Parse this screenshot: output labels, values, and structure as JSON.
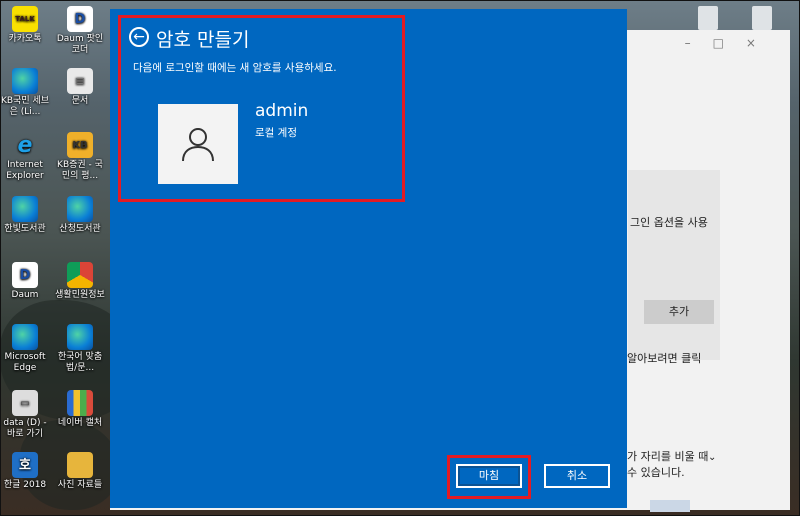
{
  "dialog": {
    "title": "암호 만들기",
    "subtitle": "다음에 로그인할 때에는 새 암호를 사용하세요.",
    "account": {
      "username": "admin",
      "type": "로컬 계정"
    },
    "buttons": {
      "finish": "마침",
      "cancel": "취소"
    },
    "icons": {
      "back": "back-arrow-icon",
      "avatar": "user-icon"
    },
    "accent_color": "#0067c0"
  },
  "desktop": {
    "icons": [
      {
        "label": "카카오톡",
        "icon": "kakaotalk-icon"
      },
      {
        "label": "Daum 팟인코더",
        "icon": "daum-icon"
      },
      {
        "label": "KB국민 세브은 (Li...",
        "icon": "edge-icon"
      },
      {
        "label": "문서",
        "icon": "document-icon"
      },
      {
        "label": "Internet Explorer",
        "icon": "ie-icon"
      },
      {
        "label": "KB증권 - 국민의 평...",
        "icon": "kb-icon"
      },
      {
        "label": "한빛도서관",
        "icon": "edge-icon"
      },
      {
        "label": "산청도서관",
        "icon": "edge-icon"
      },
      {
        "label": "Daum",
        "icon": "daum-icon"
      },
      {
        "label": "생활민원정보",
        "icon": "chrome-icon"
      },
      {
        "label": "Microsoft Edge",
        "icon": "edge-icon"
      },
      {
        "label": "한국어 맞춤법/문...",
        "icon": "edge-icon"
      },
      {
        "label": "data (D) - 바로 가기",
        "icon": "drive-icon"
      },
      {
        "label": "네이버 캘처",
        "icon": "chart-icon"
      },
      {
        "label": "한글 2018",
        "icon": "hwp-icon"
      },
      {
        "label": "사진 자료들",
        "icon": "folder-icon"
      }
    ]
  },
  "background_window": {
    "text_login_options": "그인 옵션을 사용",
    "add_button": "추가",
    "text_click": "알아보려면 클릭",
    "text_away_1": "가 자리를 비울 때",
    "text_away_2": "수 있습니다."
  }
}
